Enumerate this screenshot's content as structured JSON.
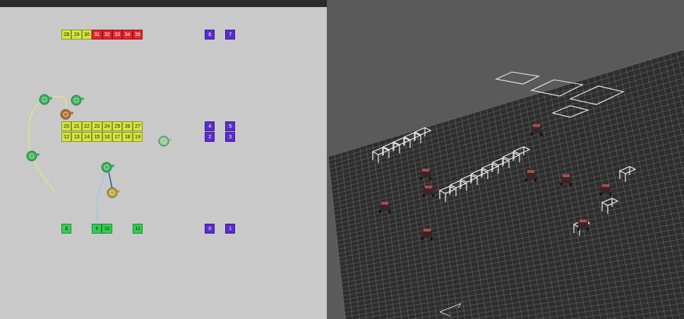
{
  "map": {
    "stationGroups": [
      {
        "stations": [
          {
            "label": "28",
            "color": "#d4e63a"
          },
          {
            "label": "29",
            "color": "#d4e63a"
          },
          {
            "label": "30",
            "color": "#d4e63a"
          },
          {
            "label": "31",
            "color": "#e8232b"
          },
          {
            "label": "32",
            "color": "#e8232b"
          },
          {
            "label": "33",
            "color": "#e8232b"
          },
          {
            "label": "34",
            "color": "#e8232b"
          },
          {
            "label": "35",
            "color": "#e8232b"
          }
        ]
      },
      {
        "stations": [
          {
            "label": "6",
            "color": "#5b2bd6"
          }
        ]
      },
      {
        "stations": [
          {
            "label": "7",
            "color": "#5b2bd6"
          }
        ]
      },
      {
        "stations": [
          {
            "label": "20",
            "color": "#d4e63a"
          },
          {
            "label": "21",
            "color": "#d4e63a"
          },
          {
            "label": "22",
            "color": "#d4e63a"
          },
          {
            "label": "23",
            "color": "#d4e63a"
          },
          {
            "label": "24",
            "color": "#d4e63a"
          },
          {
            "label": "25",
            "color": "#d4e63a"
          },
          {
            "label": "26",
            "color": "#d4e63a"
          },
          {
            "label": "27",
            "color": "#d4e63a"
          }
        ]
      },
      {
        "stations": [
          {
            "label": "12",
            "color": "#d4e63a"
          },
          {
            "label": "13",
            "color": "#d4e63a"
          },
          {
            "label": "14",
            "color": "#d4e63a"
          },
          {
            "label": "15",
            "color": "#d4e63a"
          },
          {
            "label": "16",
            "color": "#d4e63a"
          },
          {
            "label": "17",
            "color": "#d4e63a"
          },
          {
            "label": "18",
            "color": "#d4e63a"
          },
          {
            "label": "19",
            "color": "#d4e63a"
          }
        ]
      },
      {
        "stations": [
          {
            "label": "4",
            "color": "#5b2bd6"
          }
        ]
      },
      {
        "stations": [
          {
            "label": "5",
            "color": "#5b2bd6"
          }
        ]
      },
      {
        "stations": [
          {
            "label": "2",
            "color": "#5b2bd6"
          }
        ]
      },
      {
        "stations": [
          {
            "label": "3",
            "color": "#5b2bd6"
          }
        ]
      },
      {
        "stations": [
          {
            "label": "8",
            "color": "#2fd24e"
          }
        ]
      },
      {
        "stations": [
          {
            "label": "9",
            "color": "#2fd24e"
          },
          {
            "label": "10",
            "color": "#2fd24e"
          }
        ]
      },
      {
        "stations": [
          {
            "label": "11",
            "color": "#2fd24e"
          }
        ]
      },
      {
        "stations": [
          {
            "label": "0",
            "color": "#5b2bd6"
          }
        ]
      },
      {
        "stations": [
          {
            "label": "1",
            "color": "#5b2bd6"
          }
        ]
      }
    ],
    "robots": [
      {
        "color": "#37b35c",
        "path": true
      },
      {
        "color": "#37b35c",
        "path": false
      },
      {
        "color": "#37b35c",
        "path": true
      },
      {
        "color": "#37b35c",
        "path": true
      },
      {
        "color": "#8fc98a",
        "path": false
      },
      {
        "color": "#c8662e",
        "path": false
      },
      {
        "color": "#c9a03a",
        "path": false
      }
    ]
  }
}
